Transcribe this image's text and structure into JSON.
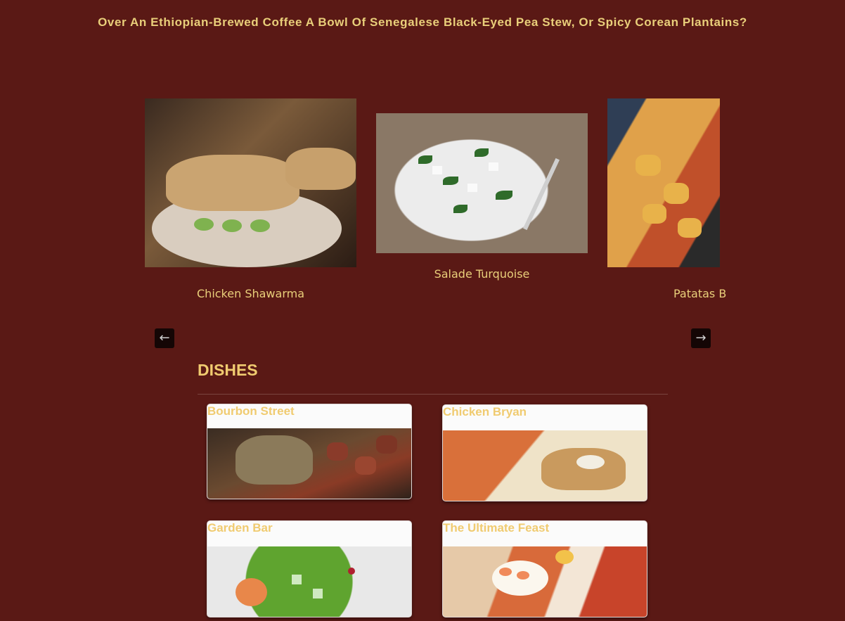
{
  "header": {
    "headline": "Over An Ethiopian-Brewed Coffee A Bowl Of Senegalese Black-Eyed Pea Stew, Or Spicy Corean Plantains?"
  },
  "carousel": {
    "slides": [
      {
        "caption": "Chicken Shawarma"
      },
      {
        "caption": "Salade Turquoise"
      },
      {
        "caption": "Patatas B"
      }
    ],
    "prev_icon": "arrow-left-icon",
    "next_icon": "arrow-right-icon"
  },
  "dishes": {
    "heading": "DISHES",
    "items": [
      {
        "title": "Bourbon Street"
      },
      {
        "title": "Chicken Bryan"
      },
      {
        "title": "Garden Bar"
      },
      {
        "title": "The Ultimate Feast"
      }
    ]
  },
  "colors": {
    "background": "#5a1915",
    "accent_gold": "#f0cb70",
    "card_bg": "#fbfbfb"
  }
}
